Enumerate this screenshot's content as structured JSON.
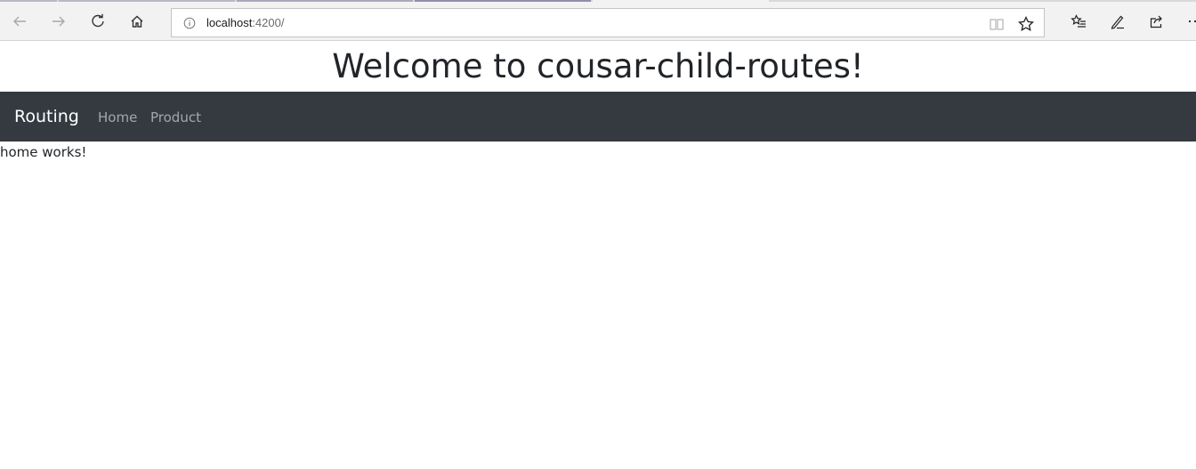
{
  "browser": {
    "address": {
      "host": "localhost",
      "port_path": ":4200/"
    },
    "icons": {
      "back": "back-arrow-icon",
      "forward": "forward-arrow-icon",
      "refresh": "refresh-icon",
      "home": "home-icon",
      "info": "info-icon",
      "reading_view": "reading-view-icon",
      "favorite": "star-icon",
      "favorites_hub": "favorites-hub-icon",
      "notes": "pen-icon",
      "share": "share-icon",
      "more": "more-icon"
    }
  },
  "page": {
    "title": "Welcome to cousar-child-routes!",
    "navbar": {
      "brand": "Routing",
      "links": [
        "Home",
        "Product"
      ],
      "background": "#343a40"
    },
    "outlet_text": "home works!"
  }
}
